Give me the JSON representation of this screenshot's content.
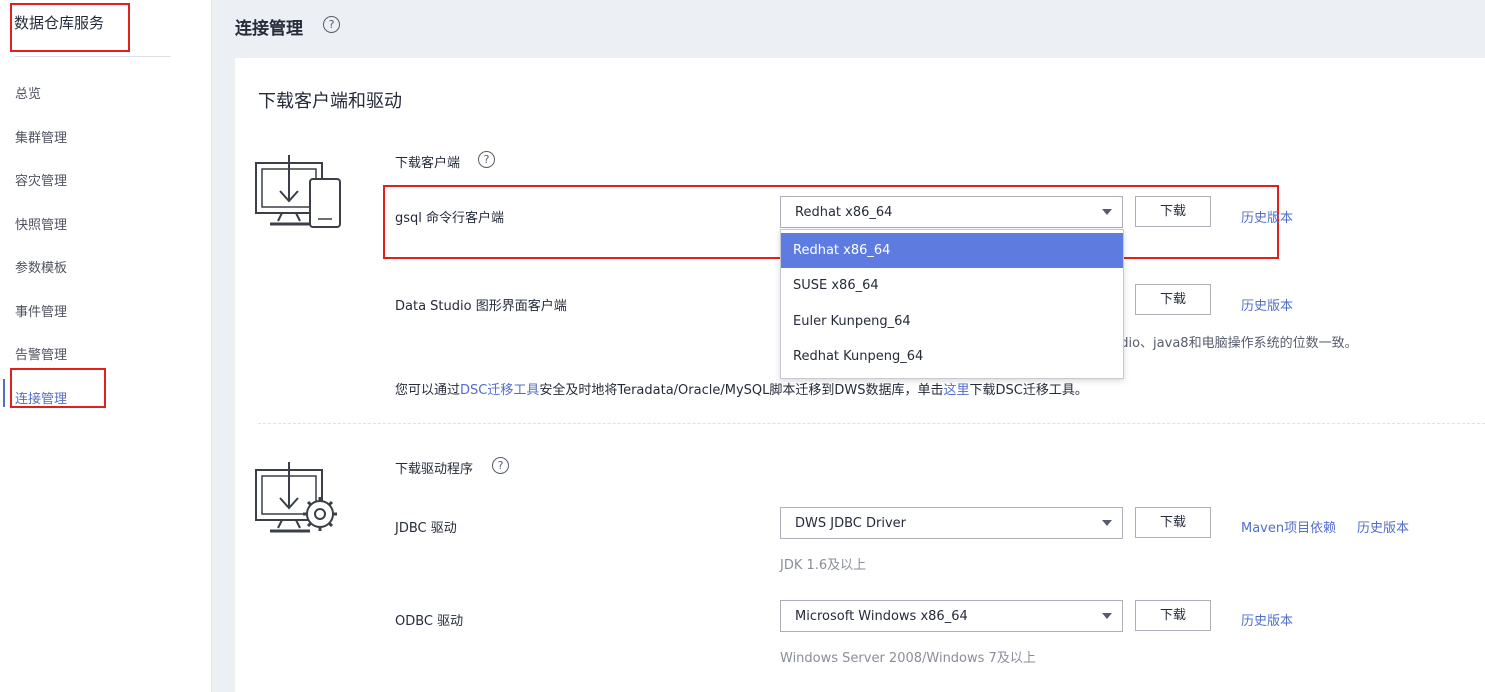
{
  "sidebar": {
    "brand": "数据仓库服务",
    "items": [
      {
        "label": "总览"
      },
      {
        "label": "集群管理"
      },
      {
        "label": "容灾管理"
      },
      {
        "label": "快照管理"
      },
      {
        "label": "参数模板"
      },
      {
        "label": "事件管理"
      },
      {
        "label": "告警管理"
      },
      {
        "label": "连接管理",
        "active": true
      }
    ]
  },
  "header": {
    "title": "连接管理",
    "help_icon": "?"
  },
  "main": {
    "section_title": "下载客户端和驱动",
    "client": {
      "title": "下载客户端",
      "help_icon": "?",
      "gsql": {
        "label": "gsql 命令行客户端",
        "selected": "Redhat x86_64",
        "download": "下载",
        "history": "历史版本",
        "options": [
          "Redhat x86_64",
          "SUSE x86_64",
          "Euler Kunpeng_64",
          "Redhat Kunpeng_64"
        ]
      },
      "data_studio": {
        "label": "Data Studio 图形界面客户端",
        "download": "下载",
        "history": "历史版本",
        "hint_tail": "udio、java8和电脑操作系统的位数一致。"
      },
      "info": {
        "pre": "您可以通过",
        "link1": "DSC迁移工具",
        "mid": "安全及时地将Teradata/Oracle/MySQL脚本迁移到DWS数据库，单击",
        "link2": "这里",
        "post": "下载DSC迁移工具。"
      }
    },
    "driver": {
      "title": "下载驱动程序",
      "help_icon": "?",
      "jdbc": {
        "label": "JDBC 驱动",
        "selected": "DWS JDBC Driver",
        "download": "下载",
        "maven": "Maven项目依赖",
        "history": "历史版本",
        "hint": "JDK 1.6及以上"
      },
      "odbc": {
        "label": "ODBC 驱动",
        "selected": "Microsoft Windows x86_64",
        "download": "下载",
        "history": "历史版本",
        "hint": "Windows Server 2008/Windows 7及以上"
      }
    }
  },
  "colors": {
    "accent": "#526ecc",
    "selected_bg": "#5e7ce0",
    "highlight_box": "#e0201f",
    "text": "#252b3a",
    "hint": "#8a8e99"
  }
}
